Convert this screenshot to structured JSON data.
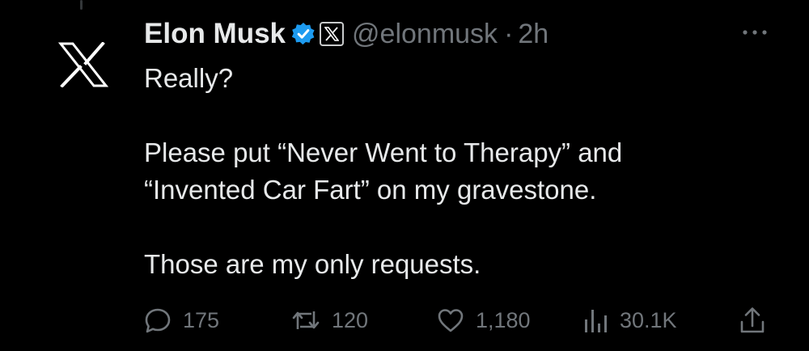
{
  "author": {
    "name": "Elon Musk",
    "handle": "@elonmusk",
    "separator": "·",
    "time": "2h",
    "avatar_icon": "x-logo-icon",
    "verified_color": "#1d9bf0"
  },
  "tweet": {
    "lines": [
      "Really?",
      "",
      "Please put “Never Went to Therapy” and",
      "“Invented Car Fart” on my gravestone.",
      "",
      "Those are my only requests."
    ]
  },
  "actions": {
    "replies": "175",
    "reposts": "120",
    "likes": "1,180",
    "views": "30.1K"
  },
  "colors": {
    "background": "#000000",
    "text": "#e7e9ea",
    "muted": "#71767b"
  }
}
